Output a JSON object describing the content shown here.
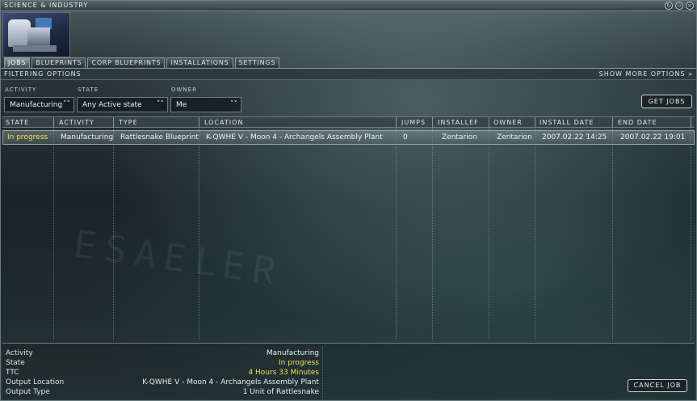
{
  "window": {
    "title": "SCIENCE & INDUSTRY",
    "controls": [
      "↻",
      "⊙",
      "×"
    ]
  },
  "tabs": [
    "JOBS",
    "BLUEPRINTS",
    "CORP BLUEPRINTS",
    "INSTALLATIONS",
    "SETTINGS"
  ],
  "filter": {
    "title": "FILTERING OPTIONS",
    "more_options": "SHOW MORE OPTIONS",
    "activity_label": "ACTIVITY",
    "activity_value": "Manufacturing",
    "state_label": "STATE",
    "state_value": "Any Active state",
    "owner_label": "OWNER",
    "owner_value": "Me",
    "get_jobs": "GET JOBS"
  },
  "table": {
    "columns": [
      "STATE",
      "ACTIVITY",
      "TYPE",
      "LOCATION",
      "JUMPS",
      "INSTALLEF",
      "OWNER",
      "INSTALL DATE",
      "END DATE"
    ],
    "rows": [
      [
        "In progress",
        "Manufacturing",
        "Rattlesnake Blueprint",
        "K-QWHE V - Moon 4 - Archangels Assembly Plant",
        "0",
        "Zentarion",
        "Zentarion",
        "2007.02.22 14:25",
        "2007.02.22 19:01"
      ]
    ]
  },
  "details": {
    "labels": [
      "Activity",
      "State",
      "TTC",
      "Output Location",
      "Output Type"
    ],
    "values": [
      "Manufacturing",
      "In progress",
      "4 Hours 33 Minutes",
      "K-QWHE V - Moon 4 - Archangels Assembly Plant",
      "1 Unit of Rattlesnake"
    ]
  },
  "cancel_job": "CANCEL JOB",
  "accent_colors": {
    "highlight_yellow": "#f0e05a",
    "frame": "#6d7c7e"
  }
}
